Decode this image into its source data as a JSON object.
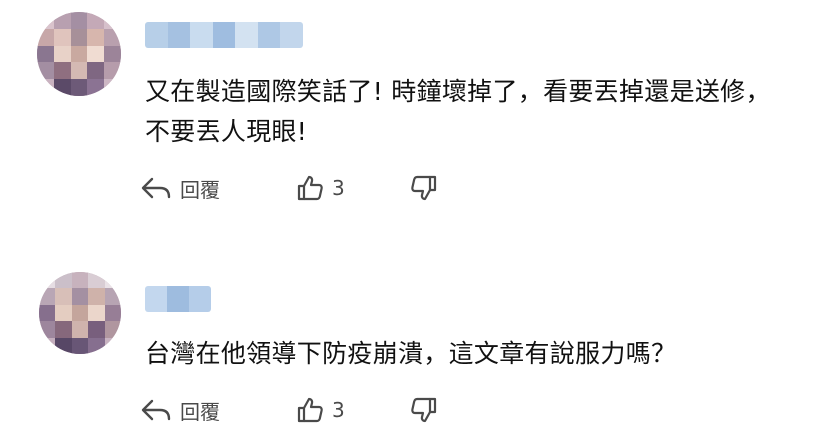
{
  "comments": [
    {
      "avatar_blurred": true,
      "avatar_colors": [
        [
          "#d9c3cc",
          "#b8a0b0",
          "#a48fa3",
          "#c4a9b7",
          "#d6c0cb"
        ],
        [
          "#c7a7a8",
          "#e0c4bd",
          "#a79099",
          "#d7b6ad",
          "#b9a0ae"
        ],
        [
          "#8a7690",
          "#e8d2c8",
          "#c9a9a0",
          "#f0dcd2",
          "#9c8499"
        ],
        [
          "#a38ea2",
          "#8f6f80",
          "#d4b9b3",
          "#7f6782",
          "#b69cab"
        ],
        [
          "#c9b2c0",
          "#5b4a68",
          "#6d5a78",
          "#8b7393",
          "#cdb7c4"
        ]
      ],
      "username_blurred": true,
      "username_colors": [
        "#b7cfe8",
        "#a5c1e1",
        "#c9dcef",
        "#9fbde0",
        "#d3e2f1",
        "#aec8e5",
        "#c2d6ec"
      ],
      "text": "又在製造國際笑話了! 時鐘壞掉了，看要丟掉還是送修，不要丟人現眼!",
      "reply_label": "回覆",
      "like_count": "3",
      "reply_icon": "reply-arrow-icon",
      "like_icon": "thumbs-up-icon",
      "dislike_icon": "thumbs-down-icon"
    },
    {
      "avatar_blurred": true,
      "avatar_colors": [
        [
          "#e6dde3",
          "#cbbfc9",
          "#c7b2bd",
          "#d9cdd4",
          "#eae2e7"
        ],
        [
          "#b9a6b5",
          "#d8bfb8",
          "#a490a2",
          "#cfb2aa",
          "#b7a4b3"
        ],
        [
          "#866f8d",
          "#e4cdc1",
          "#c4a59c",
          "#ebd6cb",
          "#977e96"
        ],
        [
          "#9d869d",
          "#86687c",
          "#cfb3ad",
          "#785f7d",
          "#b0969f"
        ],
        [
          "#c4aebd",
          "#574766",
          "#685676",
          "#866f8f",
          "#c8b3c1"
        ]
      ],
      "username_blurred": true,
      "username_colors": [
        "#c3d7ee",
        "#9ebcdf",
        "#b5cde9"
      ],
      "text": "台灣在他領導下防疫崩潰，這文章有說服力嗎？",
      "reply_label": "回覆",
      "like_count": "3",
      "reply_icon": "reply-arrow-icon",
      "like_icon": "thumbs-up-icon",
      "dislike_icon": "thumbs-down-icon"
    }
  ]
}
